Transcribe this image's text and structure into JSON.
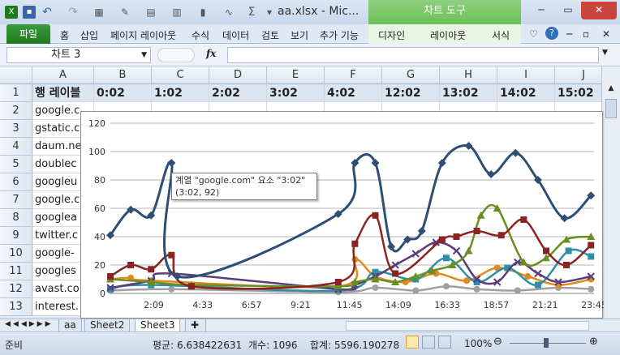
{
  "titlebar": {
    "title": "aa.xlsx  -  Mic...",
    "context_tab": "차트 도구"
  },
  "ribbon": {
    "file_tab": "파일",
    "tabs": [
      "홈",
      "삽입",
      "페이지 레이아웃",
      "수식",
      "데이터",
      "검토",
      "보기",
      "추가 기능"
    ],
    "context_tabs": [
      "디자인",
      "레이아웃",
      "서식"
    ]
  },
  "formula_bar": {
    "name_box": "차트 3",
    "fx": "fx",
    "value": ""
  },
  "grid": {
    "columns": [
      "A",
      "B",
      "C",
      "D",
      "E",
      "F",
      "G",
      "H",
      "I",
      "J"
    ],
    "row_numbers": [
      "1",
      "2",
      "3",
      "4",
      "5",
      "6",
      "7",
      "8",
      "9",
      "10",
      "11",
      "12",
      "13"
    ],
    "header_row": [
      "행 레이블",
      "0:02",
      "1:02",
      "2:02",
      "3:02",
      "4:02",
      "12:02",
      "13:02",
      "14:02",
      "15:02"
    ],
    "row_labels": [
      "google.c",
      "gstatic.c",
      "daum.ne",
      "doublec",
      "googleu",
      "google.c",
      "googlea",
      "twitter.c",
      "google-",
      "googles",
      "avast.co",
      "interest."
    ]
  },
  "tooltip": {
    "line1": "계열 \"google.com\" 요소 \"3:02\"",
    "line2": "(3:02, 92)"
  },
  "chart_data": {
    "type": "line",
    "x_tick_labels": [
      "2:09",
      "4:33",
      "6:57",
      "9:21",
      "11:45",
      "14:09",
      "16:33",
      "18:57",
      "21:21",
      "23:45"
    ],
    "y_tick_labels": [
      "0",
      "20",
      "40",
      "60",
      "80",
      "100",
      "120"
    ],
    "ylim": [
      0,
      120
    ],
    "series": [
      {
        "color": "#2e4e74",
        "marker": "diamond",
        "x": [
          0.02,
          1.02,
          2.02,
          3.02,
          3.3,
          11.2,
          12.02,
          13.02,
          13.8,
          14.6,
          15.3,
          16.3,
          17.6,
          18.7,
          19.9,
          21.0,
          22.3,
          23.6
        ],
        "values": [
          41,
          59,
          55,
          92,
          12,
          56,
          92,
          92,
          33,
          38,
          44,
          92,
          104,
          84,
          99,
          80,
          53,
          69
        ]
      },
      {
        "color": "#8b2323",
        "marker": "square",
        "x": [
          0.02,
          1.02,
          2.02,
          3.02,
          4.0,
          11.2,
          12.02,
          13.02,
          14.0,
          16.3,
          17.0,
          18.0,
          19.2,
          20.3,
          21.4,
          22.4,
          23.6
        ],
        "values": [
          12,
          20,
          17,
          27,
          5,
          8,
          35,
          55,
          14,
          38,
          40,
          44,
          41,
          52,
          30,
          20,
          34
        ]
      },
      {
        "color": "#6b8e23",
        "marker": "triangle",
        "x": [
          0.02,
          2.02,
          4.0,
          11.2,
          12.02,
          13.02,
          14.0,
          15.0,
          15.8,
          16.8,
          17.6,
          18.2,
          19.0,
          20.3,
          21.4,
          22.4,
          23.6
        ],
        "values": [
          10,
          8,
          6,
          5,
          8,
          10,
          8,
          12,
          16,
          20,
          30,
          55,
          60,
          22,
          25,
          38,
          40
        ]
      },
      {
        "color": "#5a3d7a",
        "marker": "x",
        "x": [
          0.02,
          2.02,
          3.02,
          11.2,
          12.02,
          13.02,
          14.0,
          15.0,
          16.0,
          17.0,
          18.0,
          19.0,
          20.0,
          21.0,
          22.0,
          23.6
        ],
        "values": [
          4,
          9,
          14,
          3,
          6,
          12,
          20,
          28,
          36,
          30,
          10,
          8,
          22,
          14,
          8,
          12
        ]
      },
      {
        "color": "#2f8fa8",
        "marker": "square",
        "x": [
          0.02,
          2.02,
          11.2,
          13.02,
          15.0,
          16.5,
          18.0,
          19.5,
          21.0,
          22.5,
          23.6
        ],
        "values": [
          3,
          6,
          2,
          15,
          10,
          25,
          8,
          18,
          6,
          30,
          26
        ]
      },
      {
        "color": "#e08a1e",
        "marker": "circle",
        "x": [
          0.02,
          1.02,
          2.02,
          11.2,
          12.02,
          13.02,
          14.5,
          16.0,
          17.5,
          19.0,
          20.5,
          22.0,
          23.6
        ],
        "values": [
          10,
          11,
          9,
          5,
          24,
          12,
          8,
          14,
          9,
          18,
          12,
          6,
          10
        ]
      },
      {
        "color": "#a0a0a0",
        "marker": "circle",
        "x": [
          0.02,
          3.02,
          11.2,
          13.02,
          15.0,
          16.5,
          18.0,
          20.0,
          22.0,
          23.6
        ],
        "values": [
          2,
          3,
          1,
          4,
          2,
          5,
          3,
          2,
          4,
          3
        ]
      }
    ]
  },
  "sheet_tabs": [
    "aa",
    "Sheet2",
    "Sheet3"
  ],
  "status": {
    "ready": "준비",
    "average": "평균: 6.638422631",
    "count": "개수: 1096",
    "sum": "합계: 5596.190278",
    "zoom": "100%"
  }
}
